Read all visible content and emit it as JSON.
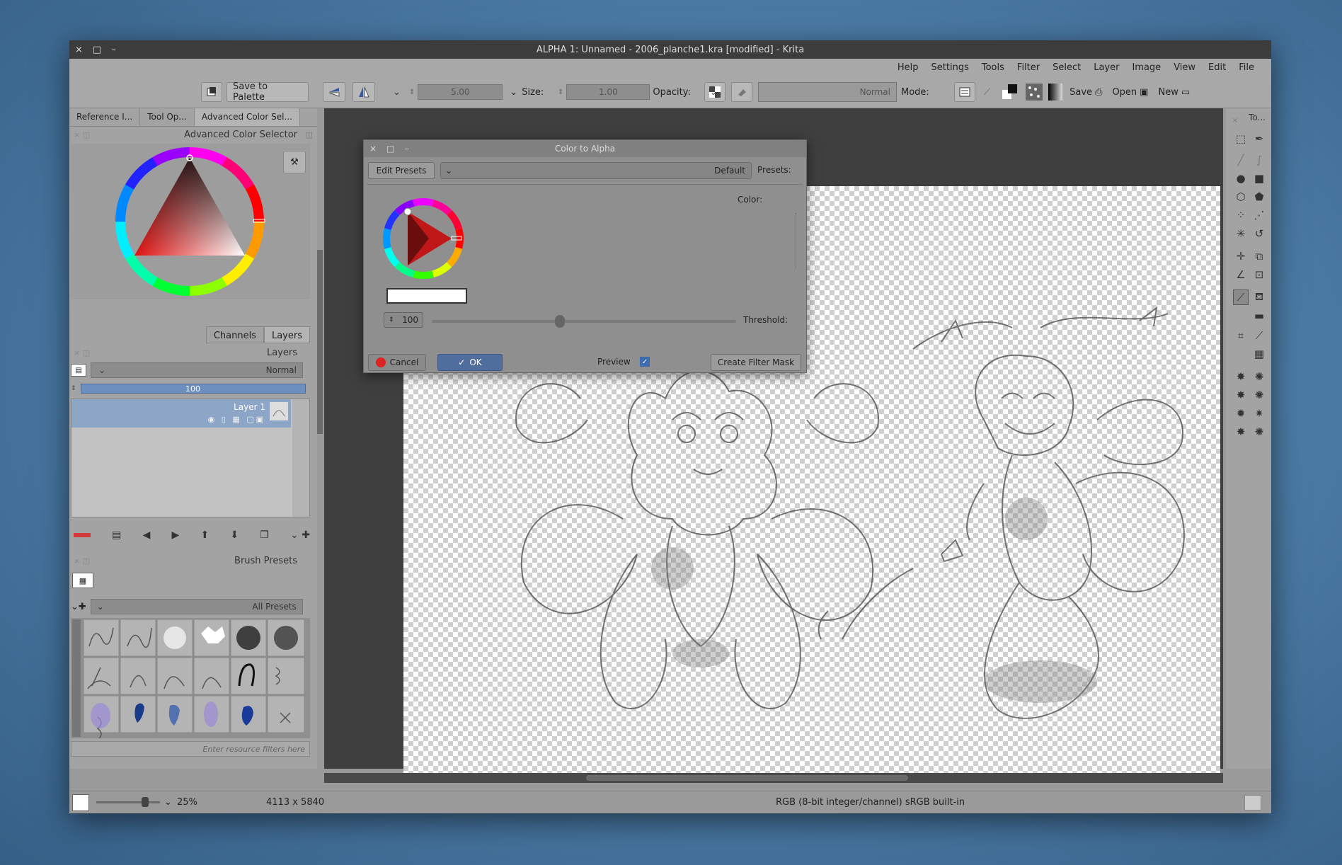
{
  "window": {
    "title": "ALPHA 1: Unnamed - 2006_planche1.kra [modified] - Krita",
    "controls": [
      "×",
      "□",
      "–"
    ]
  },
  "menu": [
    "Help",
    "Settings",
    "Tools",
    "Filter",
    "Select",
    "Layer",
    "Image",
    "View",
    "Edit",
    "File"
  ],
  "toolbar": {
    "save_to_palette": "Save to Palette",
    "size_label": "Size:",
    "size_value": "5.00",
    "opacity_label": "Opacity:",
    "opacity_value": "1.00",
    "mode_label": "Mode:",
    "mode_value": "Normal",
    "save_label": "Save",
    "open_label": "Open",
    "new_label": "New"
  },
  "left_dock": {
    "top_tabs": [
      "Reference I...",
      "Tool Op...",
      "Advanced Color Sel..."
    ],
    "color_selector_title": "Advanced Color Selector",
    "layer_tabs": [
      "Channels",
      "Layers"
    ],
    "layers_title": "Layers",
    "blend_mode": "Normal",
    "opacity": "100",
    "layer_name": "Layer 1",
    "brush_presets_title": "Brush Presets",
    "brush_filter": "All Presets",
    "resource_filter_placeholder": "Enter resource filters here"
  },
  "dialog": {
    "title": "Color to Alpha",
    "controls": [
      "×",
      "□",
      "–"
    ],
    "presets_label": "Presets:",
    "presets_value": "Default",
    "edit_presets": "Edit Presets",
    "color_label": "Color:",
    "threshold_label": "Threshold:",
    "threshold_value": "100",
    "threshold_fraction": 0.42,
    "create_filter_mask": "Create Filter Mask",
    "preview_label": "Preview",
    "preview_checked": true,
    "ok": "OK",
    "cancel": "Cancel"
  },
  "status": {
    "color_space": "RGB (8-bit integer/channel)  sRGB built-in",
    "dimensions": "4113 x 5840",
    "zoom": "25%"
  },
  "right_toolbox": {
    "title": "To..."
  },
  "colors": {
    "accent_blue": "#6d8fc0",
    "window_bg": "#9a9a9a",
    "canvas_bg": "#3f3f3f"
  }
}
